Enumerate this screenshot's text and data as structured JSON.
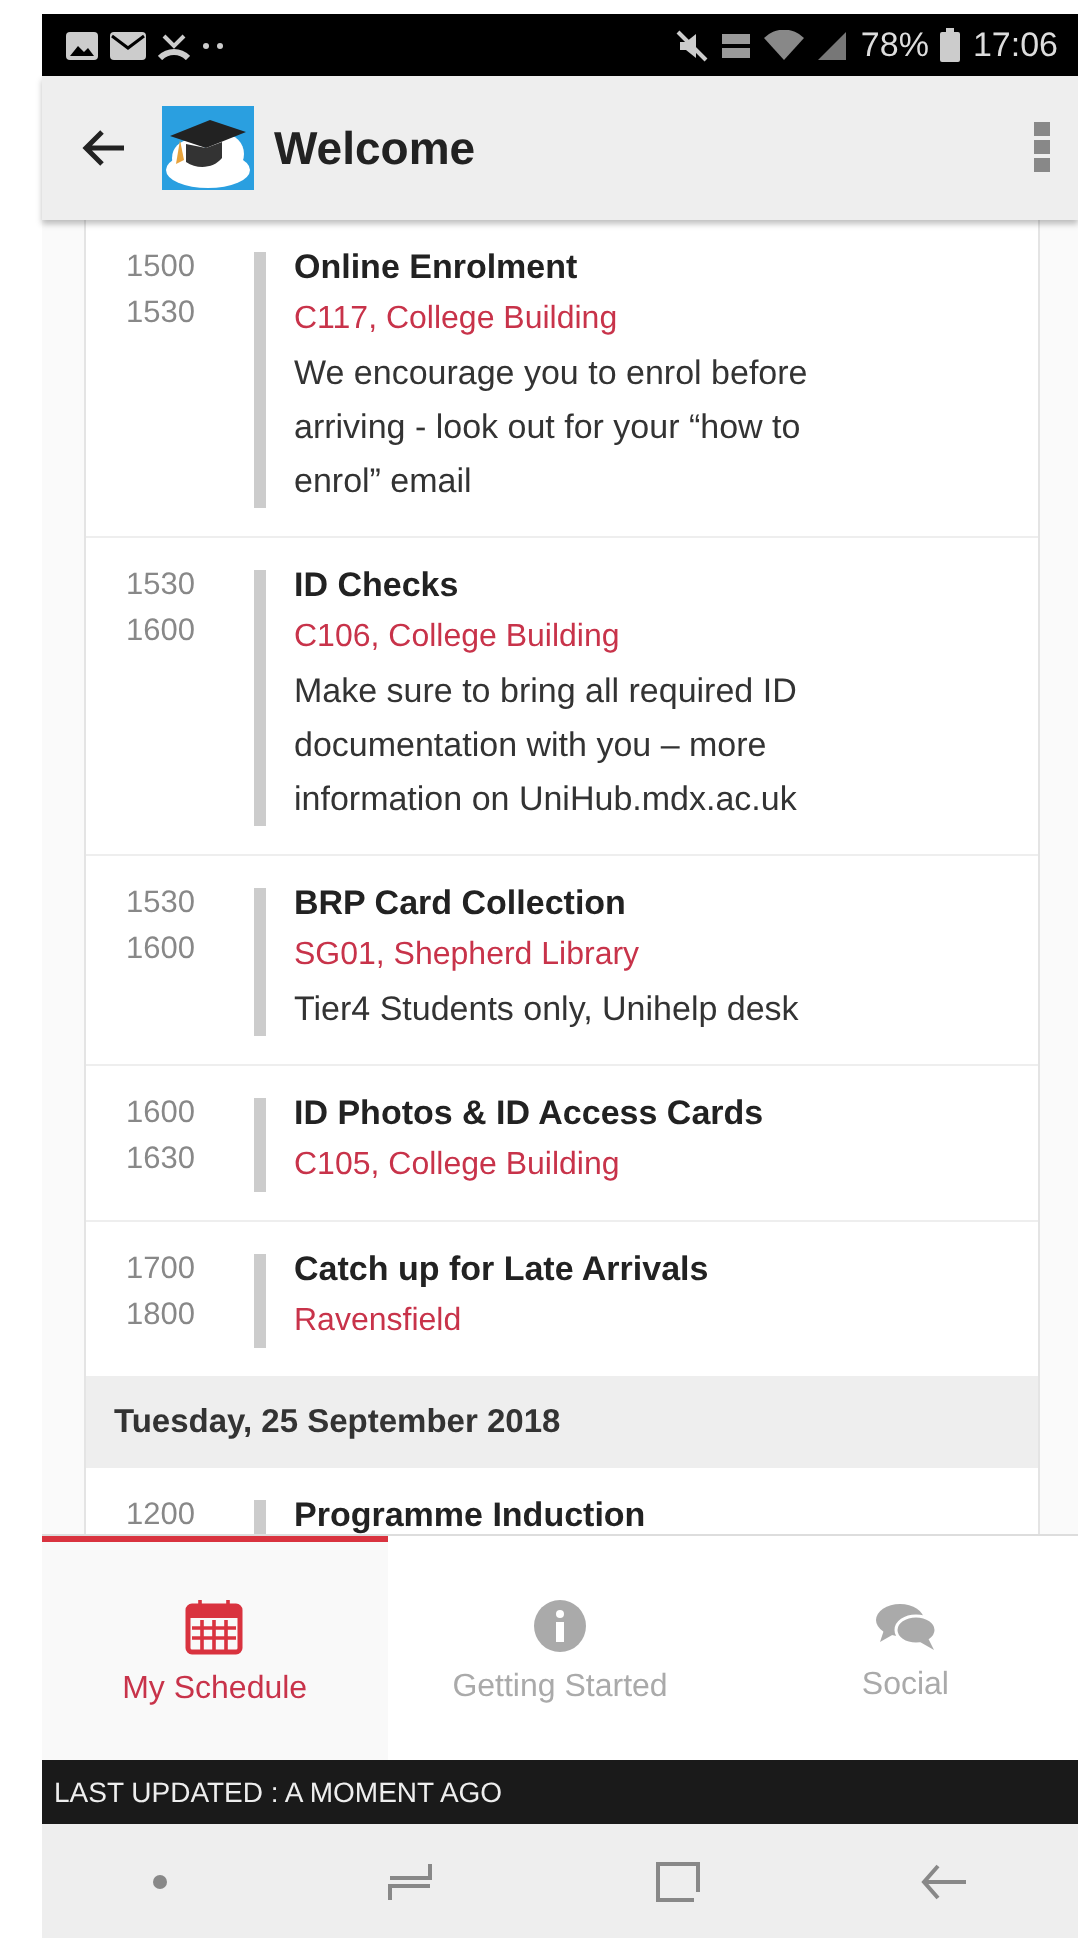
{
  "status_bar": {
    "battery": "78%",
    "time": "17:06"
  },
  "app_bar": {
    "title": "Welcome"
  },
  "schedule": [
    {
      "kind": "event",
      "start": "1500",
      "end": "1530",
      "title": "Online Enrolment",
      "location": "C117, College Building",
      "description": "We encourage you to enrol before arriving - look out for your “how to enrol” email"
    },
    {
      "kind": "event",
      "start": "1530",
      "end": "1600",
      "title": "ID Checks",
      "location": "C106, College Building",
      "description": "Make sure to bring all required ID documentation with you – more information on UniHub.mdx.ac.uk"
    },
    {
      "kind": "event",
      "start": "1530",
      "end": "1600",
      "title": "BRP Card Collection",
      "location": "SG01, Shepherd Library",
      "description": "Tier4 Students only, Unihelp desk"
    },
    {
      "kind": "event",
      "start": "1600",
      "end": "1630",
      "title": "ID Photos & ID Access Cards",
      "location": "C105, College Building"
    },
    {
      "kind": "event",
      "start": "1700",
      "end": "1800",
      "title": "Catch up for Late Arrivals",
      "location": "Ravensfield"
    },
    {
      "kind": "day",
      "title": "Tuesday, 25 September 2018"
    },
    {
      "kind": "event",
      "start": "1200",
      "title": "Programme Induction"
    }
  ],
  "tabs": [
    {
      "label": "My Schedule",
      "selected": true
    },
    {
      "label": "Getting Started",
      "selected": false
    },
    {
      "label": "Social",
      "selected": false
    }
  ],
  "update_banner": "LAST UPDATED : A MOMENT AGO"
}
